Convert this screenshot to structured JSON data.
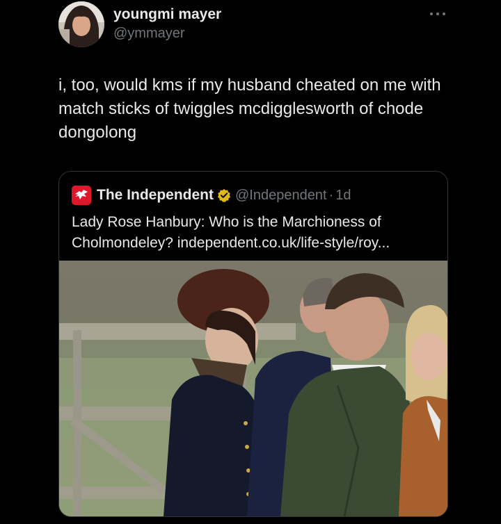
{
  "author": {
    "display_name": "youngmi mayer",
    "handle": "@ymmayer",
    "avatar_icon": "profile-photo"
  },
  "more_icon": "more-horizontal-icon",
  "tweet": {
    "text": "i, too, would kms if my husband cheated on me with match sticks of twiggles mcdigglesworth of chode dongolong"
  },
  "quote": {
    "name": "The Independent",
    "handle": "@Independent",
    "separator": "·",
    "time": "1d",
    "text": "Lady Rose Hanbury: Who is the Marchioness of Cholmondeley? independent.co.uk/life-style/roy...",
    "logo_icon": "eagle-logo",
    "verified_icon": "gold-verified-badge",
    "image_desc_icon": "news-photo"
  },
  "colors": {
    "background": "#000000",
    "text_primary": "#e7e9ea",
    "text_secondary": "#71767b",
    "card_border": "#2f3336",
    "brand_red": "#e0162b",
    "verified_gold": "#e2b719"
  }
}
